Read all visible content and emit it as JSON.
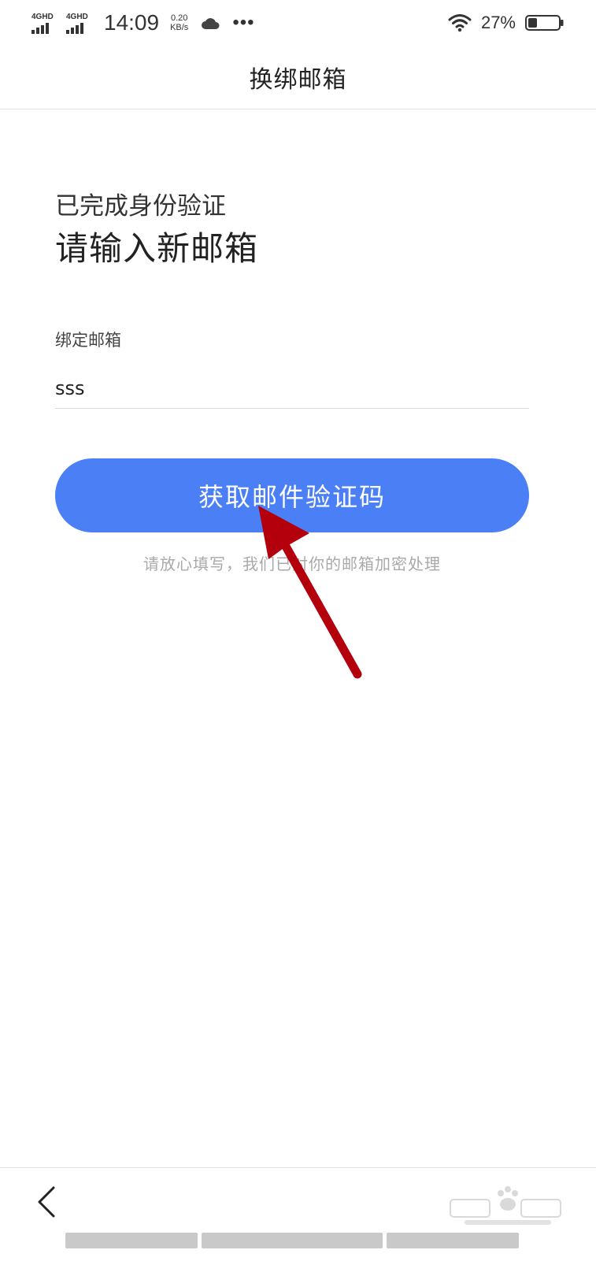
{
  "status_bar": {
    "signal1_label": "4GHD",
    "signal2_label": "4GHD",
    "time": "14:09",
    "speed_value": "0.20",
    "speed_unit": "KB/s",
    "more_dots": "•••",
    "battery_percent": "27%",
    "icons": [
      "signal-icon",
      "cloud-icon",
      "wifi-icon",
      "battery-icon"
    ]
  },
  "header": {
    "title": "换绑邮箱"
  },
  "main": {
    "heading_small": "已完成身份验证",
    "heading_large": "请输入新邮箱",
    "field_label": "绑定邮箱",
    "email_value": "sss",
    "button_label": "获取邮件验证码",
    "hint": "请放心填写，我们已对你的邮箱加密处理"
  },
  "bottom_bar": {
    "icons": [
      "back-icon",
      "baidu-watermark-icon"
    ]
  },
  "colors": {
    "accent": "#4a7ff6",
    "annotation_arrow": "#b3000c",
    "hint": "#a9a9a9"
  }
}
